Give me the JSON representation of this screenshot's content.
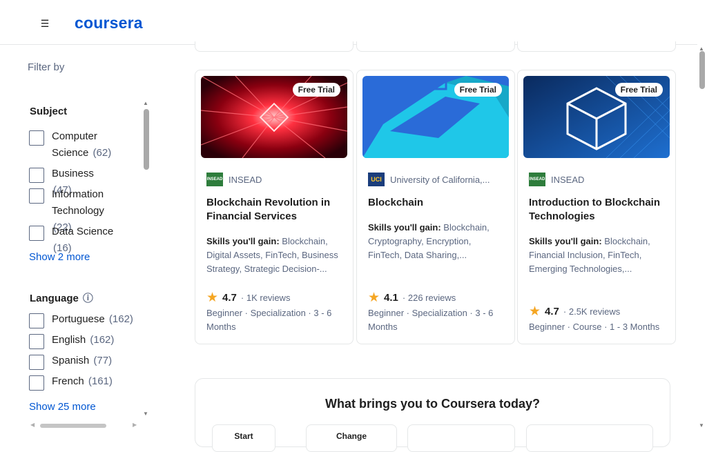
{
  "header": {
    "logo": "coursera",
    "menu_icon": "menu-icon"
  },
  "sidebar": {
    "filter_by": "Filter by",
    "subject": {
      "title": "Subject",
      "options": [
        {
          "label": "Computer Science",
          "count": "(62)"
        },
        {
          "label": "Business",
          "count": "(47)"
        },
        {
          "label": "Information Technology",
          "count": "(22)"
        },
        {
          "label": "Data Science",
          "count": "(16)"
        }
      ],
      "show_more": "Show 2 more"
    },
    "language": {
      "title": "Language",
      "info": "ⓘ",
      "options": [
        {
          "label": "Portuguese",
          "count": "(162)"
        },
        {
          "label": "English",
          "count": "(162)"
        },
        {
          "label": "Spanish",
          "count": "(77)"
        },
        {
          "label": "French",
          "count": "(161)"
        }
      ],
      "show_more": "Show 25 more"
    }
  },
  "cards": [
    {
      "badge": "Free Trial",
      "partner": "INSEAD",
      "title": "Blockchain Revolution in Financial Services",
      "skills_label": "Skills you'll gain:",
      "skills": "Blockchain, Digital Assets, FinTech, Business Strategy, Strategic Decision-...",
      "rating": "4.7",
      "reviews": "1K reviews",
      "meta": "Beginner · Specialization · 3 - 6 Months"
    },
    {
      "badge": "Free Trial",
      "partner": "University of California,...",
      "title": "Blockchain",
      "skills_label": "Skills you'll gain:",
      "skills": "Blockchain, Cryptography, Encryption, FinTech, Data Sharing,...",
      "rating": "4.1",
      "reviews": "226 reviews",
      "meta": "Beginner · Specialization · 3 - 6 Months"
    },
    {
      "badge": "Free Trial",
      "partner": "INSEAD",
      "title": "Introduction to Blockchain Technologies",
      "skills_label": "Skills you'll gain:",
      "skills": "Blockchain, Financial Inclusion, FinTech, Emerging Technologies,...",
      "rating": "4.7",
      "reviews": "2.5K reviews",
      "meta": "Beginner · Course · 1 - 3 Months"
    }
  ],
  "brings": {
    "title": "What brings you to Coursera today?",
    "options": [
      "Start",
      "Change",
      "",
      ""
    ]
  },
  "colors": {
    "brand": "#0056d2",
    "star": "#f5a623",
    "muted": "#5b6780"
  }
}
